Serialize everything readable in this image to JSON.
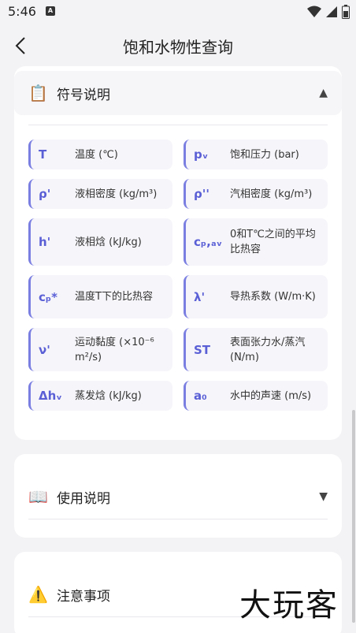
{
  "status": {
    "time": "5:46",
    "app_icon_letter": "A"
  },
  "app_bar": {
    "title": "饱和水物性查询"
  },
  "symbols_card": {
    "icon": "clipboard-icon",
    "title": "符号说明",
    "arrow": "▲",
    "items": [
      {
        "symbol": "T",
        "desc": "温度 (℃)"
      },
      {
        "symbol": "pᵥ",
        "desc": "饱和压力 (bar)"
      },
      {
        "symbol": "ρ'",
        "desc": "液相密度 (kg/m³)"
      },
      {
        "symbol": "ρ''",
        "desc": "汽相密度 (kg/m³)"
      },
      {
        "symbol": "h'",
        "desc": "液相焓 (kJ/kg)"
      },
      {
        "symbol": "cₚ,ₐᵥ",
        "desc": "0和T℃之间的平均比热容"
      },
      {
        "symbol": "cₚ*",
        "desc": "温度T下的比热容"
      },
      {
        "symbol": "λ'",
        "desc": "导热系数 (W/m·K)"
      },
      {
        "symbol": "ν'",
        "desc": "运动黏度 (×10⁻⁶ m²/s)"
      },
      {
        "symbol": "ST",
        "desc": "表面张力水/蒸汽 (N/m)"
      },
      {
        "symbol": "Δhᵥ",
        "desc": "蒸发焓 (kJ/kg)"
      },
      {
        "symbol": "a₀",
        "desc": "水中的声速 (m/s)"
      }
    ]
  },
  "usage_card": {
    "icon": "book-icon",
    "title": "使用说明",
    "arrow": "▼"
  },
  "notes_card": {
    "icon": "warning-icon",
    "title": "注意事项"
  },
  "watermark": "大玩客",
  "colors": {
    "accent": "#5a5fd6",
    "accent_border": "#7a7ee0",
    "background": "#f3f3f5"
  }
}
